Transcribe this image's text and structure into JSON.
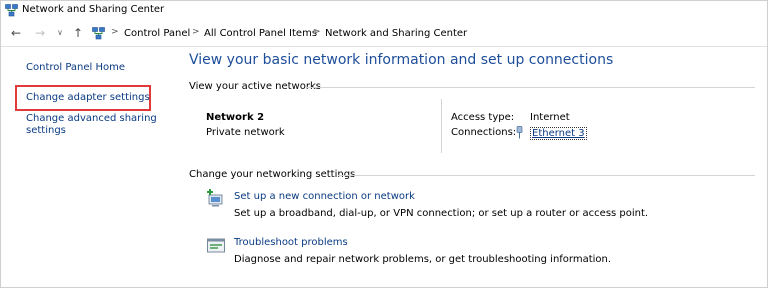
{
  "window": {
    "title": "Network and Sharing Center",
    "icon": "network-center-icon"
  },
  "nav": {
    "back_icon": "arrow-left-icon",
    "forward_icon": "arrow-right-icon",
    "recent_icon": "chevron-down-icon",
    "up_icon": "arrow-up-icon",
    "separator": ">",
    "breadcrumbs": [
      {
        "label": "Control Panel"
      },
      {
        "label": "All Control Panel Items"
      },
      {
        "label": "Network and Sharing Center"
      }
    ]
  },
  "sidebar": {
    "items": [
      {
        "label": "Control Panel Home"
      },
      {
        "label": "Change adapter settings",
        "highlighted": true
      },
      {
        "label_line1": "Change advanced sharing",
        "label_line2": "settings"
      }
    ],
    "highlight_color": "#e03a3a"
  },
  "main": {
    "heading": "View your basic network information and set up connections",
    "active_networks": {
      "section_title": "View your active networks",
      "network_name": "Network 2",
      "network_category": "Private network",
      "access_type_label": "Access type:",
      "access_type_value": "Internet",
      "connections_label": "Connections:",
      "connections_value": "Ethernet 3"
    },
    "networking_settings": {
      "section_title": "Change your networking settings",
      "tasks": [
        {
          "link": "Set up a new connection or network",
          "description": "Set up a broadband, dial-up, or VPN connection; or set up a router or access point.",
          "icon": "new-connection-icon"
        },
        {
          "link": "Troubleshoot problems",
          "description": "Diagnose and repair network problems, or get troubleshooting information.",
          "icon": "troubleshoot-icon"
        }
      ]
    }
  },
  "colors": {
    "link": "#0a3a82",
    "heading": "#1e4e9a",
    "highlight": "#e03a3a"
  }
}
